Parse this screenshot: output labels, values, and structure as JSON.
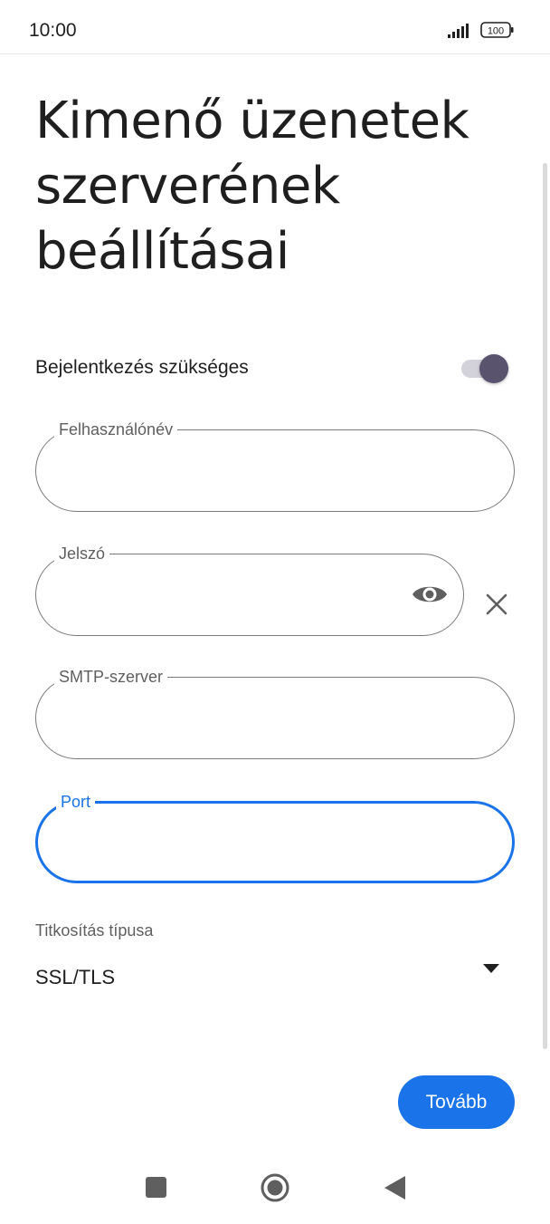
{
  "status_bar": {
    "time": "10:00",
    "battery": "100",
    "icons": [
      "signal-icon",
      "battery-icon"
    ]
  },
  "page": {
    "title": "Kimenő üzenetek szerverének beállításai"
  },
  "login_required": {
    "label": "Bejelentkezés szükséges",
    "enabled": true
  },
  "fields": {
    "username": {
      "label": "Felhasználónév",
      "value": ""
    },
    "password": {
      "label": "Jelszó",
      "value": "",
      "icons": [
        "eye-icon",
        "close-icon"
      ]
    },
    "smtp": {
      "label": "SMTP-szerver",
      "value": ""
    },
    "port": {
      "label": "Port",
      "value": "",
      "focused": true
    }
  },
  "encryption": {
    "label": "Titkosítás típusa",
    "value": "SSL/TLS",
    "icon": "dropdown-arrow-icon"
  },
  "actions": {
    "next_label": "Tovább"
  },
  "colors": {
    "accent": "#1a73e8",
    "toggle_thumb": "#5a536e",
    "toggle_track": "#d3d1da",
    "outline": "#7a7a7a"
  },
  "nav_bar": {
    "icons": [
      "recents-icon",
      "home-icon",
      "back-icon"
    ]
  }
}
